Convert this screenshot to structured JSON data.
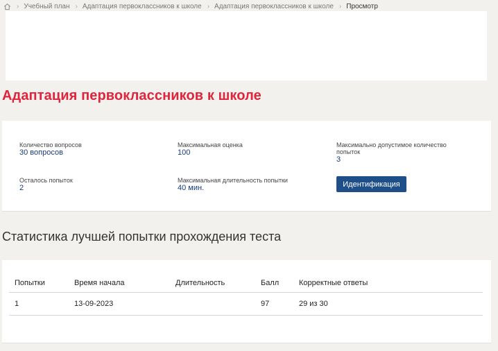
{
  "breadcrumb": {
    "home_icon": "home-icon",
    "items": [
      "Учебный план",
      "Адаптация первоклассников к школе",
      "Адаптация первоклассников к школе"
    ],
    "current": "Просмотр"
  },
  "page_title": "Адаптация первоклассников к школе",
  "info": {
    "questions_label": "Количество вопросов",
    "questions_value": "30 вопросов",
    "max_score_label": "Максимальная оценка",
    "max_score_value": "100",
    "max_attempts_label": "Максимально допустимое количество попыток",
    "max_attempts_value": "3",
    "attempts_left_label": "Осталось попыток",
    "attempts_left_value": "2",
    "max_duration_label": "Максимальная длительность попытки",
    "max_duration_value": "40 мин.",
    "identify_button": "Идентификация"
  },
  "stats": {
    "title": "Статистика лучшей попытки прохождения теста",
    "columns": [
      "Попытки",
      "Время начала",
      "Длительность",
      "Балл",
      "Корректные ответы"
    ],
    "rows": [
      [
        "1",
        "13-09-2023",
        "",
        "97",
        "29 из 30"
      ]
    ]
  },
  "colors": {
    "title": "#e0243c",
    "value": "#173a7a",
    "button": "#1f4f88",
    "background": "#f2f1ee"
  }
}
